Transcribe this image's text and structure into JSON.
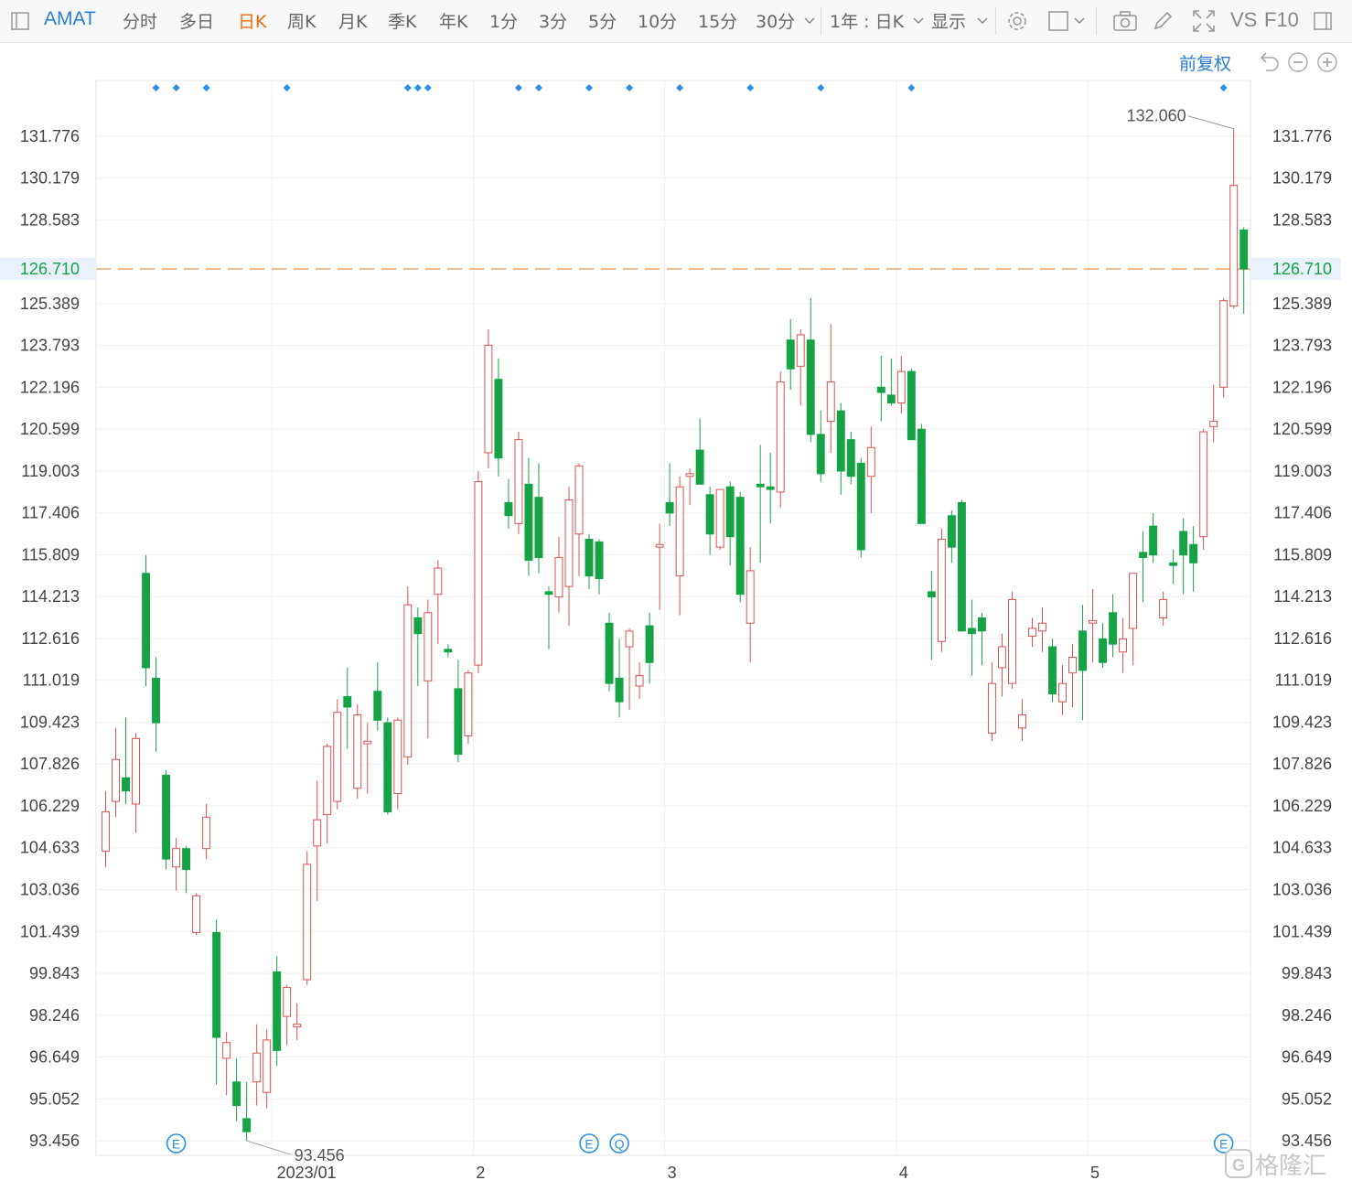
{
  "toolbar": {
    "symbol": "AMAT",
    "periods": [
      "分时",
      "多日",
      "日K",
      "周K",
      "月K",
      "季K",
      "年K",
      "1分",
      "3分",
      "5分",
      "10分",
      "15分",
      "30分"
    ],
    "active_period": "日K",
    "range_select": "1年 : 日K",
    "display_label": "显示",
    "vs_label": "VS",
    "f10_label": "F10"
  },
  "adjust_label": "前复权",
  "watermark": "格隆汇",
  "colors": {
    "up": "#d9534f",
    "down": "#15a345",
    "accent": "#2a7fd4",
    "current": "#e8a050",
    "current_label": "#15a345",
    "active": "#f06b0e"
  },
  "chart_data": {
    "type": "candlestick",
    "symbol": "AMAT",
    "period": "日K",
    "y_ticks": [
      "131.776",
      "130.179",
      "128.583",
      "126.710",
      "125.389",
      "123.793",
      "122.196",
      "120.599",
      "119.003",
      "117.406",
      "115.809",
      "114.213",
      "112.616",
      "111.019",
      "109.423",
      "107.826",
      "106.229",
      "104.633",
      "103.036",
      "101.439",
      "99.843",
      "98.246",
      "96.649",
      "95.052",
      "93.456"
    ],
    "y_range": [
      92.9,
      133.9
    ],
    "current_price": "126.710",
    "high_label": "132.060",
    "low_label": "93.456",
    "x_labels": [
      {
        "label": "2023/01",
        "index": 17
      },
      {
        "label": "2",
        "index": 37
      },
      {
        "label": "3",
        "index": 56
      },
      {
        "label": "4",
        "index": 79
      },
      {
        "label": "5",
        "index": 98
      }
    ],
    "dividend_marks": [
      5,
      7,
      10,
      18,
      30,
      31,
      32,
      41,
      43,
      48,
      52,
      57,
      64,
      71,
      80,
      111
    ],
    "events": [
      {
        "index": 7,
        "label": "E"
      },
      {
        "index": 48,
        "label": "E"
      },
      {
        "index": 51,
        "label": "Q"
      },
      {
        "index": 111,
        "label": "E"
      }
    ],
    "candles": [
      {
        "o": 104.5,
        "h": 106.8,
        "l": 103.9,
        "c": 106.0
      },
      {
        "o": 106.4,
        "h": 109.2,
        "l": 105.8,
        "c": 108.0
      },
      {
        "o": 107.3,
        "h": 109.6,
        "l": 106.3,
        "c": 106.8
      },
      {
        "o": 106.3,
        "h": 109.0,
        "l": 105.2,
        "c": 108.8
      },
      {
        "o": 115.1,
        "h": 115.8,
        "l": 110.8,
        "c": 111.5
      },
      {
        "o": 111.1,
        "h": 111.9,
        "l": 108.3,
        "c": 109.4
      },
      {
        "o": 107.4,
        "h": 107.6,
        "l": 103.8,
        "c": 104.2
      },
      {
        "o": 103.9,
        "h": 105.0,
        "l": 103.0,
        "c": 104.6
      },
      {
        "o": 104.6,
        "h": 104.7,
        "l": 102.9,
        "c": 103.8
      },
      {
        "o": 101.4,
        "h": 102.9,
        "l": 101.3,
        "c": 102.8
      },
      {
        "o": 104.6,
        "h": 106.3,
        "l": 104.2,
        "c": 105.8
      },
      {
        "o": 101.4,
        "h": 101.9,
        "l": 95.6,
        "c": 97.4
      },
      {
        "o": 96.6,
        "h": 97.6,
        "l": 95.2,
        "c": 97.2
      },
      {
        "o": 95.7,
        "h": 96.6,
        "l": 94.2,
        "c": 94.8
      },
      {
        "o": 94.3,
        "h": 95.7,
        "l": 93.456,
        "c": 93.8
      },
      {
        "o": 95.7,
        "h": 97.9,
        "l": 94.8,
        "c": 96.8
      },
      {
        "o": 95.3,
        "h": 97.7,
        "l": 94.7,
        "c": 97.3
      },
      {
        "o": 99.9,
        "h": 100.5,
        "l": 96.3,
        "c": 96.9
      },
      {
        "o": 98.2,
        "h": 99.4,
        "l": 97.1,
        "c": 99.3
      },
      {
        "o": 97.8,
        "h": 98.7,
        "l": 97.3,
        "c": 97.9
      },
      {
        "o": 99.6,
        "h": 104.5,
        "l": 99.4,
        "c": 104.0
      },
      {
        "o": 104.7,
        "h": 107.2,
        "l": 102.6,
        "c": 105.7
      },
      {
        "o": 105.9,
        "h": 108.6,
        "l": 104.8,
        "c": 108.5
      },
      {
        "o": 106.4,
        "h": 110.3,
        "l": 106.1,
        "c": 109.8
      },
      {
        "o": 110.4,
        "h": 111.5,
        "l": 108.4,
        "c": 110.0
      },
      {
        "o": 106.9,
        "h": 110.1,
        "l": 106.5,
        "c": 109.7
      },
      {
        "o": 108.6,
        "h": 109.4,
        "l": 106.7,
        "c": 108.7
      },
      {
        "o": 110.6,
        "h": 111.7,
        "l": 109.1,
        "c": 109.5
      },
      {
        "o": 109.4,
        "h": 109.6,
        "l": 105.9,
        "c": 106.0
      },
      {
        "o": 106.7,
        "h": 109.6,
        "l": 106.1,
        "c": 109.5
      },
      {
        "o": 108.1,
        "h": 114.6,
        "l": 107.8,
        "c": 113.9
      },
      {
        "o": 113.4,
        "h": 113.8,
        "l": 110.8,
        "c": 112.8
      },
      {
        "o": 111.0,
        "h": 114.1,
        "l": 108.8,
        "c": 113.6
      },
      {
        "o": 114.3,
        "h": 115.6,
        "l": 112.4,
        "c": 115.3
      },
      {
        "o": 112.2,
        "h": 112.4,
        "l": 111.9,
        "c": 112.1
      },
      {
        "o": 110.7,
        "h": 111.8,
        "l": 107.9,
        "c": 108.2
      },
      {
        "o": 108.9,
        "h": 111.4,
        "l": 108.6,
        "c": 111.3
      },
      {
        "o": 111.6,
        "h": 119.0,
        "l": 111.3,
        "c": 118.6
      },
      {
        "o": 119.7,
        "h": 124.4,
        "l": 119.1,
        "c": 123.8
      },
      {
        "o": 122.5,
        "h": 123.3,
        "l": 118.8,
        "c": 119.5
      },
      {
        "o": 117.8,
        "h": 118.7,
        "l": 116.8,
        "c": 117.3
      },
      {
        "o": 117.0,
        "h": 120.5,
        "l": 116.6,
        "c": 120.2
      },
      {
        "o": 118.5,
        "h": 119.5,
        "l": 115.0,
        "c": 115.6
      },
      {
        "o": 118.0,
        "h": 119.3,
        "l": 115.1,
        "c": 115.7
      },
      {
        "o": 114.4,
        "h": 114.6,
        "l": 112.2,
        "c": 114.3
      },
      {
        "o": 114.2,
        "h": 116.5,
        "l": 113.6,
        "c": 115.7
      },
      {
        "o": 114.6,
        "h": 118.4,
        "l": 113.1,
        "c": 117.9
      },
      {
        "o": 116.6,
        "h": 119.3,
        "l": 115.0,
        "c": 119.2
      },
      {
        "o": 116.4,
        "h": 116.6,
        "l": 114.5,
        "c": 115.0
      },
      {
        "o": 116.3,
        "h": 116.4,
        "l": 114.3,
        "c": 114.9
      },
      {
        "o": 113.2,
        "h": 113.6,
        "l": 110.6,
        "c": 110.9
      },
      {
        "o": 111.1,
        "h": 112.6,
        "l": 109.6,
        "c": 110.2
      },
      {
        "o": 112.3,
        "h": 113.0,
        "l": 109.9,
        "c": 112.9
      },
      {
        "o": 110.8,
        "h": 111.7,
        "l": 110.3,
        "c": 111.2
      },
      {
        "o": 113.1,
        "h": 113.6,
        "l": 110.9,
        "c": 111.7
      },
      {
        "o": 116.1,
        "h": 117.0,
        "l": 113.7,
        "c": 116.2
      },
      {
        "o": 117.8,
        "h": 119.3,
        "l": 116.9,
        "c": 117.4
      },
      {
        "o": 115.0,
        "h": 118.8,
        "l": 113.5,
        "c": 118.4
      },
      {
        "o": 118.8,
        "h": 119.1,
        "l": 117.7,
        "c": 118.9
      },
      {
        "o": 119.8,
        "h": 121.0,
        "l": 118.5,
        "c": 118.5
      },
      {
        "o": 118.1,
        "h": 118.4,
        "l": 115.8,
        "c": 116.6
      },
      {
        "o": 116.1,
        "h": 117.9,
        "l": 116.0,
        "c": 118.3
      },
      {
        "o": 118.4,
        "h": 118.6,
        "l": 115.4,
        "c": 116.5
      },
      {
        "o": 118.0,
        "h": 118.2,
        "l": 114.0,
        "c": 114.3
      },
      {
        "o": 113.2,
        "h": 116.1,
        "l": 111.7,
        "c": 115.2
      },
      {
        "o": 118.5,
        "h": 120.0,
        "l": 115.5,
        "c": 118.4
      },
      {
        "o": 118.4,
        "h": 119.7,
        "l": 117.0,
        "c": 118.3
      },
      {
        "o": 118.2,
        "h": 122.8,
        "l": 117.6,
        "c": 122.4
      },
      {
        "o": 124.0,
        "h": 124.8,
        "l": 122.1,
        "c": 122.9
      },
      {
        "o": 123.0,
        "h": 124.4,
        "l": 121.5,
        "c": 124.2
      },
      {
        "o": 124.0,
        "h": 125.6,
        "l": 120.1,
        "c": 120.4
      },
      {
        "o": 120.4,
        "h": 121.3,
        "l": 118.6,
        "c": 118.9
      },
      {
        "o": 120.9,
        "h": 124.6,
        "l": 119.7,
        "c": 122.4
      },
      {
        "o": 121.3,
        "h": 121.6,
        "l": 118.1,
        "c": 119.0
      },
      {
        "o": 120.2,
        "h": 120.5,
        "l": 118.5,
        "c": 118.8
      },
      {
        "o": 119.3,
        "h": 119.5,
        "l": 115.7,
        "c": 116.0
      },
      {
        "o": 118.8,
        "h": 120.7,
        "l": 117.4,
        "c": 119.9
      },
      {
        "o": 122.2,
        "h": 123.4,
        "l": 120.9,
        "c": 122.0
      },
      {
        "o": 121.9,
        "h": 123.3,
        "l": 121.5,
        "c": 121.6
      },
      {
        "o": 121.6,
        "h": 123.4,
        "l": 121.2,
        "c": 122.8
      },
      {
        "o": 122.8,
        "h": 122.9,
        "l": 120.2,
        "c": 120.2
      },
      {
        "o": 120.6,
        "h": 120.8,
        "l": 117.8,
        "c": 117.0
      },
      {
        "o": 114.4,
        "h": 115.2,
        "l": 111.8,
        "c": 114.2
      },
      {
        "o": 112.5,
        "h": 116.8,
        "l": 112.1,
        "c": 116.4
      },
      {
        "o": 117.3,
        "h": 117.5,
        "l": 115.5,
        "c": 116.1
      },
      {
        "o": 117.8,
        "h": 117.9,
        "l": 113.0,
        "c": 112.9
      },
      {
        "o": 113.0,
        "h": 114.1,
        "l": 111.2,
        "c": 112.8
      },
      {
        "o": 113.4,
        "h": 113.6,
        "l": 111.6,
        "c": 112.9
      },
      {
        "o": 109.0,
        "h": 111.7,
        "l": 108.7,
        "c": 110.9
      },
      {
        "o": 111.5,
        "h": 112.8,
        "l": 110.4,
        "c": 112.3
      },
      {
        "o": 110.9,
        "h": 114.4,
        "l": 110.7,
        "c": 114.1
      },
      {
        "o": 109.2,
        "h": 110.3,
        "l": 108.7,
        "c": 109.7
      },
      {
        "o": 112.7,
        "h": 113.4,
        "l": 112.3,
        "c": 113.0
      },
      {
        "o": 112.9,
        "h": 113.8,
        "l": 112.1,
        "c": 113.2
      },
      {
        "o": 112.3,
        "h": 112.6,
        "l": 110.2,
        "c": 110.5
      },
      {
        "o": 110.2,
        "h": 111.6,
        "l": 109.7,
        "c": 110.9
      },
      {
        "o": 111.3,
        "h": 112.4,
        "l": 110.0,
        "c": 111.9
      },
      {
        "o": 112.9,
        "h": 113.9,
        "l": 109.5,
        "c": 111.4
      },
      {
        "o": 113.2,
        "h": 114.5,
        "l": 111.7,
        "c": 113.3
      },
      {
        "o": 112.6,
        "h": 113.2,
        "l": 111.5,
        "c": 111.7
      },
      {
        "o": 113.6,
        "h": 114.3,
        "l": 111.9,
        "c": 112.4
      },
      {
        "o": 112.1,
        "h": 113.4,
        "l": 111.3,
        "c": 112.6
      },
      {
        "o": 113.0,
        "h": 114.8,
        "l": 111.6,
        "c": 115.1
      },
      {
        "o": 115.9,
        "h": 116.7,
        "l": 114.0,
        "c": 115.7
      },
      {
        "o": 116.9,
        "h": 117.4,
        "l": 115.5,
        "c": 115.8
      },
      {
        "o": 113.4,
        "h": 114.4,
        "l": 113.1,
        "c": 114.1
      },
      {
        "o": 115.5,
        "h": 116.0,
        "l": 114.7,
        "c": 115.4
      },
      {
        "o": 116.7,
        "h": 117.2,
        "l": 114.3,
        "c": 115.8
      },
      {
        "o": 116.2,
        "h": 116.9,
        "l": 114.4,
        "c": 115.5
      },
      {
        "o": 116.5,
        "h": 120.6,
        "l": 116.0,
        "c": 120.5
      },
      {
        "o": 120.7,
        "h": 122.3,
        "l": 120.1,
        "c": 120.9
      },
      {
        "o": 122.2,
        "h": 125.6,
        "l": 121.8,
        "c": 125.5
      },
      {
        "o": 125.3,
        "h": 132.06,
        "l": 125.2,
        "c": 129.9
      },
      {
        "o": 128.2,
        "h": 128.3,
        "l": 125.0,
        "c": 126.71
      }
    ]
  }
}
